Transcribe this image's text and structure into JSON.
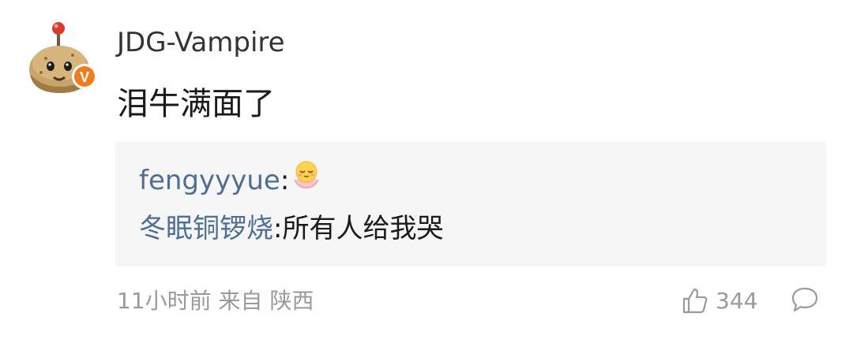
{
  "comment": {
    "username": "JDG-Vampire",
    "text": "泪牛满面了",
    "verified_badge": "V",
    "avatar_icon": "potato-mine-avatar-icon"
  },
  "replies": [
    {
      "user": "fengyyyue",
      "separator": ":",
      "text": "",
      "emoji": "smiling-lotus-emoji"
    },
    {
      "user": "冬眠铜锣烧",
      "separator": ":",
      "text": "所有人给我哭"
    }
  ],
  "meta": {
    "time": "11小时前",
    "source": "来自 陕西"
  },
  "actions": {
    "like_count": "344",
    "like_icon": "thumbs-up-icon",
    "comment_icon": "comment-bubble-icon"
  },
  "colors": {
    "username_link": "#4e6e95",
    "badge": "#f07d1d",
    "reply_background": "#f6f6f6",
    "meta_text": "#9a9a9a"
  }
}
